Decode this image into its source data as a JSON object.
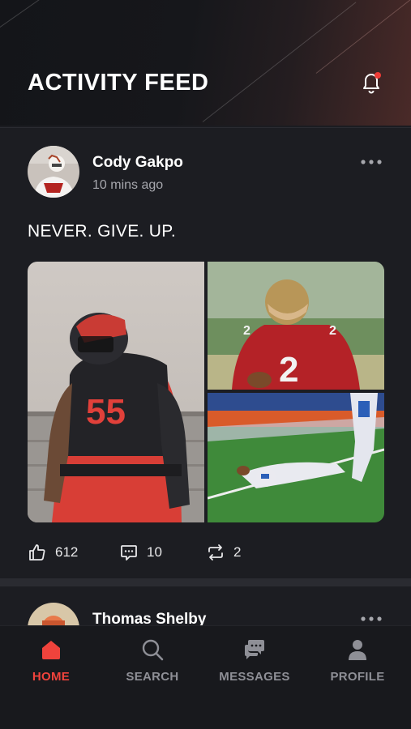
{
  "header": {
    "title": "ACTIVITY FEED",
    "notification_dot_color": "#ef3b36"
  },
  "posts": [
    {
      "username": "Cody Gakpo",
      "time": "10 mins ago",
      "caption": "NEVER. GIVE. UP.",
      "likes": "612",
      "comments": "10",
      "reposts": "2",
      "images": [
        "player-55-portrait",
        "quarterback-2-photo",
        "diving-catch-photo"
      ]
    },
    {
      "username": "Thomas Shelby"
    }
  ],
  "tabs": [
    {
      "label": "HOME",
      "icon": "home-icon",
      "active": true
    },
    {
      "label": "SEARCH",
      "icon": "search-icon",
      "active": false
    },
    {
      "label": "MESSAGES",
      "icon": "messages-icon",
      "active": false
    },
    {
      "label": "PROFILE",
      "icon": "profile-icon",
      "active": false
    }
  ],
  "colors": {
    "accent": "#f0433c",
    "background": "#1c1d22",
    "inactive": "#8e8f96"
  }
}
